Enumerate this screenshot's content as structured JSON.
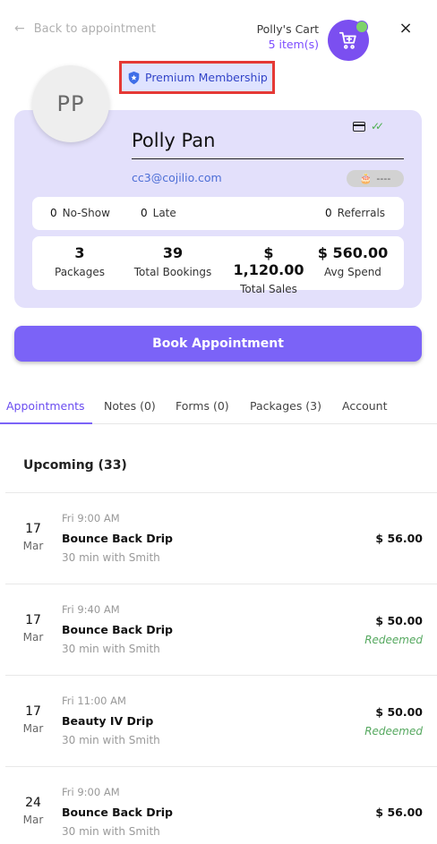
{
  "header": {
    "back_label": "Back to appointment",
    "cart_owner": "Polly's Cart",
    "cart_count": "5 item(s)",
    "close_label": "×"
  },
  "profile": {
    "initials": "PP",
    "membership": "Premium Membership",
    "name": "Polly Pan",
    "email": "cc3@cojilio.com",
    "birthday": "----"
  },
  "counters": [
    {
      "value": "0",
      "label": "No-Show"
    },
    {
      "value": "0",
      "label": "Late"
    },
    {
      "value": "0",
      "label": "Referrals"
    }
  ],
  "stats": [
    {
      "value": "3",
      "label": "Packages"
    },
    {
      "value": "39",
      "label": "Total Bookings"
    },
    {
      "value": "$ 1,120.00",
      "label": "Total Sales"
    },
    {
      "value": "$ 560.00",
      "label": "Avg Spend"
    }
  ],
  "book_button": "Book Appointment",
  "tabs": [
    {
      "label": "Appointments",
      "active": true
    },
    {
      "label": "Notes (0)"
    },
    {
      "label": "Forms (0)"
    },
    {
      "label": "Packages (3)"
    },
    {
      "label": "Account"
    }
  ],
  "upcoming_title": "Upcoming (33)",
  "appointments": [
    {
      "day": "17",
      "month": "Mar",
      "time": "Fri 9:00 AM",
      "service": "Bounce Back Drip",
      "detail": "30 min with Smith",
      "price": "$ 56.00",
      "status": ""
    },
    {
      "day": "17",
      "month": "Mar",
      "time": "Fri 9:40 AM",
      "service": "Bounce Back Drip",
      "detail": "30 min with Smith",
      "price": "$ 50.00",
      "status": "Redeemed"
    },
    {
      "day": "17",
      "month": "Mar",
      "time": "Fri 11:00 AM",
      "service": "Beauty IV Drip",
      "detail": "30 min with Smith",
      "price": "$ 50.00",
      "status": "Redeemed"
    },
    {
      "day": "24",
      "month": "Mar",
      "time": "Fri 9:00 AM",
      "service": "Bounce Back Drip",
      "detail": "30 min with Smith",
      "price": "$ 56.00",
      "status": ""
    }
  ],
  "colors": {
    "accent": "#7b63f7",
    "card_bg": "#e3e0fb",
    "redeemed": "#55a85f",
    "highlight_border": "#e53935"
  },
  "icons": {
    "back": "arrow-left-icon",
    "cart": "shopping-cart-icon",
    "close": "close-icon",
    "membership": "shield-star-icon",
    "card": "credit-card-icon",
    "verified": "double-check-icon",
    "birthday": "cake-icon"
  }
}
